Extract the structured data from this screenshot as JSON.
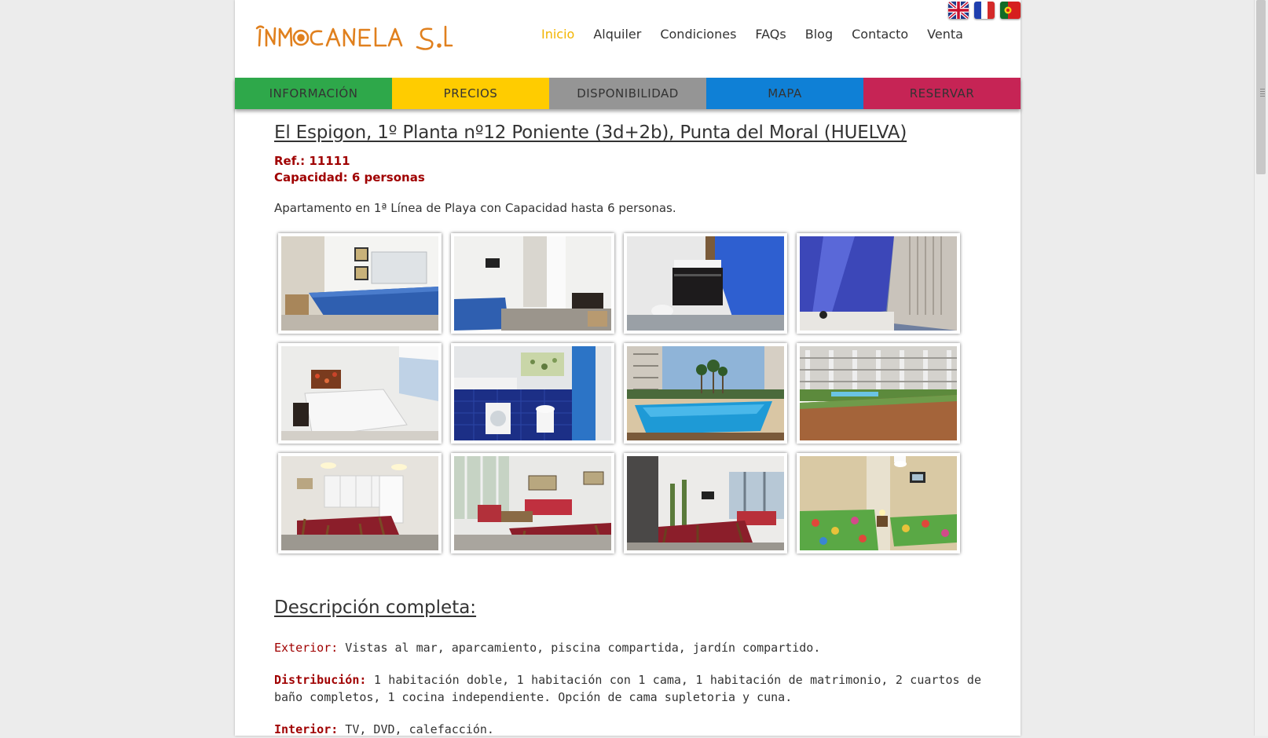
{
  "header": {
    "logo_text": "INMOCANELA S.L",
    "flags": [
      {
        "name": "uk-flag-icon",
        "lang": "English"
      },
      {
        "name": "france-flag-icon",
        "lang": "Français"
      },
      {
        "name": "portugal-flag-icon",
        "lang": "Português"
      }
    ],
    "nav": [
      {
        "label": "Inicio",
        "active": true
      },
      {
        "label": "Alquiler"
      },
      {
        "label": "Condiciones"
      },
      {
        "label": "FAQs"
      },
      {
        "label": "Blog"
      },
      {
        "label": "Contacto"
      },
      {
        "label": "Venta"
      }
    ]
  },
  "tabs": [
    {
      "label": "INFORMACIÓN",
      "color": "#2ea84a"
    },
    {
      "label": "PRECIOS",
      "color": "#ffcc00"
    },
    {
      "label": "DISPONIBILIDAD",
      "color": "#959595"
    },
    {
      "label": "MAPA",
      "color": "#0f80d6"
    },
    {
      "label": "RESERVAR",
      "color": "#c62455"
    }
  ],
  "property": {
    "title": "El Espigon, 1º Planta nº12 Poniente (3d+2b), Punta del Moral (HUELVA)",
    "ref": "Ref.: 11111",
    "capacity": "Capacidad: 6 personas",
    "intro": "Apartamento en 1ª Línea de Playa con Capacidad hasta 6 personas."
  },
  "gallery": [
    {
      "photo": "bedroom-single-blue"
    },
    {
      "photo": "bedroom-hallway"
    },
    {
      "photo": "bathroom-sink"
    },
    {
      "photo": "bathroom-shower-curtain"
    },
    {
      "photo": "double-bedroom"
    },
    {
      "photo": "bathroom-washer"
    },
    {
      "photo": "pool-view"
    },
    {
      "photo": "garden-terrace"
    },
    {
      "photo": "kitchen-dining"
    },
    {
      "photo": "living-room"
    },
    {
      "photo": "dining-area"
    },
    {
      "photo": "twin-bedroom"
    }
  ],
  "description": {
    "heading": "Descripción completa:",
    "exterior_label": "Exterior:",
    "exterior_text": " Vistas al mar, aparcamiento, piscina compartida, jardín compartido.",
    "distribucion_label": "Distribución:",
    "distribucion_text": " 1 habitación doble,  1 habitación con 1 cama, 1 habitación de matrimonio, 2 cuartos de baño completos, 1 cocina independiente. Opción de cama supletoria y cuna.",
    "interior_label": "Interior:",
    "interior_text": " TV, DVD, calefacción."
  },
  "colors": {
    "accent_active_nav": "#f2b400",
    "label_red": "#a00000",
    "logo_orange": "#e0801e"
  }
}
